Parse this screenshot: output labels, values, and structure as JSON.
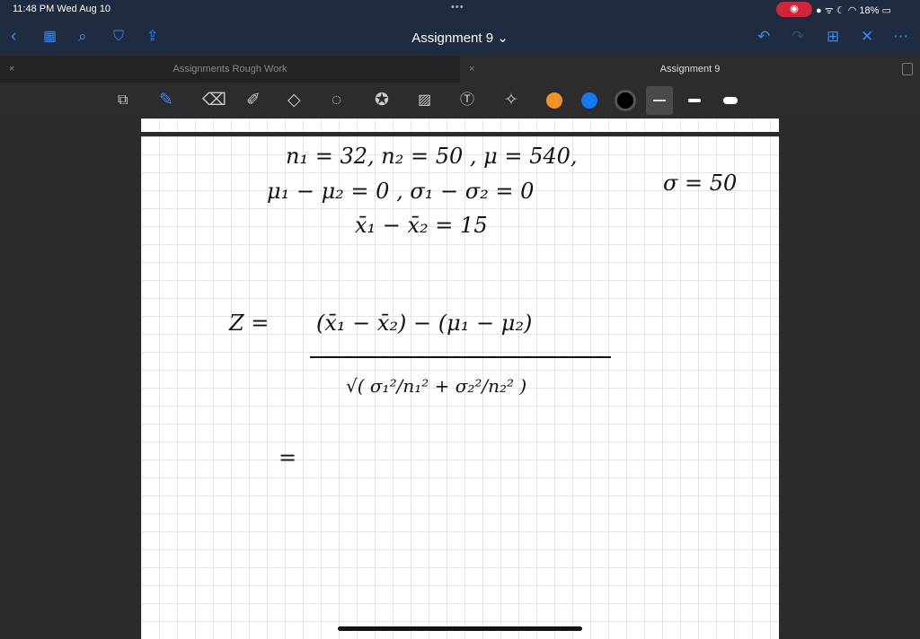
{
  "status": {
    "time": "11:48 PM  Wed Aug 10",
    "battery": "18%",
    "record_icon": "record-icon",
    "accent": "#d0243a"
  },
  "nav": {
    "title": "Assignment 9 ⌄",
    "icons": [
      "back-icon",
      "grid-icon",
      "search-icon",
      "bookmark-icon",
      "share-icon",
      "undo-icon",
      "redo-icon",
      "add-page-icon",
      "close-icon",
      "more-icon"
    ],
    "accent": "#3a86f0"
  },
  "tabs": [
    {
      "label": "Assignments Rough Work",
      "active": false
    },
    {
      "label": "Assignment 9",
      "active": true
    }
  ],
  "toolbar": {
    "tools": [
      "zoom-window",
      "pen",
      "eraser",
      "highlighter",
      "shapes",
      "lasso",
      "sticker",
      "image",
      "text",
      "laser"
    ],
    "colors": [
      "#f0922a",
      "#1a73f0",
      "#000000"
    ]
  },
  "notes": {
    "line1": "n₁ = 32,    n₂ = 50   , μ = 540,",
    "line1b": "σ = 50",
    "line2": "μ₁ − μ₂ = 0  ,   σ₁ − σ₂ = 0",
    "line3": "x̄₁ − x̄₂ = 15",
    "z_label": "Z =",
    "numerator": "(x̄₁ −  x̄₂) − (μ₁ − μ₂)",
    "denominator": "√( σ₁²/n₁²  +  σ₂²/n₂² )",
    "equals": "="
  }
}
